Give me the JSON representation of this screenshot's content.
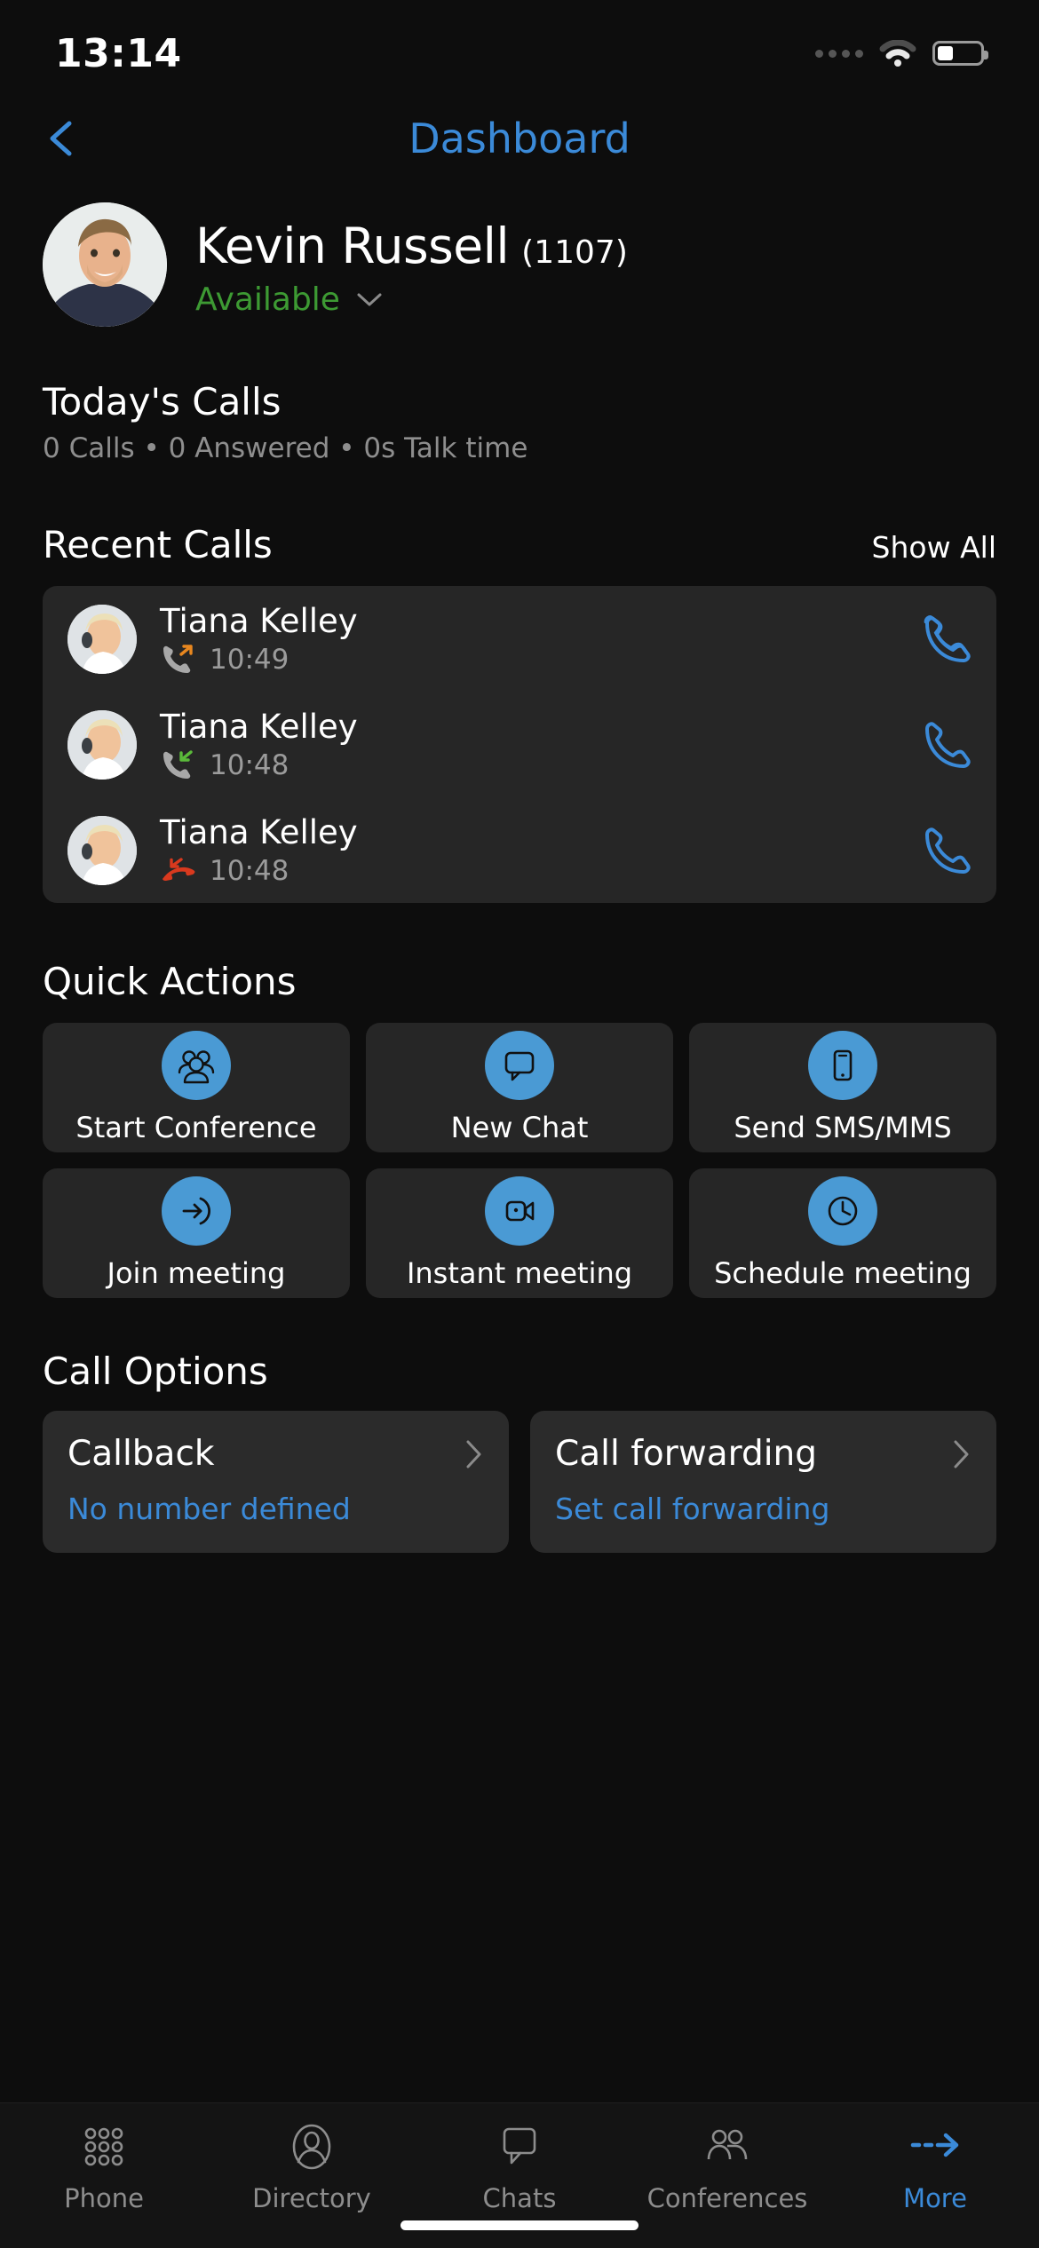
{
  "statusbar": {
    "time": "13:14",
    "signal_icon": "signal-dots-icon",
    "wifi_icon": "wifi-icon",
    "battery_icon": "battery-icon"
  },
  "navbar": {
    "back_icon": "chevron-left-icon",
    "title": "Dashboard"
  },
  "profile": {
    "avatar_icon": "user-avatar-photo",
    "name": "Kevin Russell",
    "extension": "(1107)",
    "status": "Available",
    "status_chevron_icon": "chevron-down-icon"
  },
  "today": {
    "title": "Today's Calls",
    "summary": "0 Calls • 0 Answered • 0s Talk time"
  },
  "recent": {
    "title": "Recent Calls",
    "show_all": "Show All",
    "calls": [
      {
        "name": "Tiana Kelley",
        "time": "10:49",
        "direction": "outgoing",
        "direction_icon": "call-outgoing-icon",
        "action_icon": "phone-call-icon",
        "avatar_icon": "contact-avatar-photo"
      },
      {
        "name": "Tiana Kelley",
        "time": "10:48",
        "direction": "incoming",
        "direction_icon": "call-incoming-icon",
        "action_icon": "phone-call-icon",
        "avatar_icon": "contact-avatar-photo"
      },
      {
        "name": "Tiana Kelley",
        "time": "10:48",
        "direction": "missed",
        "direction_icon": "call-missed-icon",
        "action_icon": "phone-call-icon",
        "avatar_icon": "contact-avatar-photo"
      }
    ]
  },
  "quick_actions": {
    "title": "Quick Actions",
    "tiles": [
      {
        "label": "Start Conference",
        "icon": "group-people-icon"
      },
      {
        "label": "New Chat",
        "icon": "speech-bubble-icon"
      },
      {
        "label": "Send SMS/MMS",
        "icon": "mobile-phone-icon"
      },
      {
        "label": "Join meeting",
        "icon": "arrow-enter-icon"
      },
      {
        "label": "Instant meeting",
        "icon": "video-camera-icon"
      },
      {
        "label": "Schedule meeting",
        "icon": "clock-icon"
      }
    ]
  },
  "call_options": {
    "title": "Call Options",
    "cards": [
      {
        "title": "Callback",
        "subtitle": "No number defined",
        "chevron_icon": "chevron-right-icon"
      },
      {
        "title": "Call forwarding",
        "subtitle": "Set call forwarding",
        "chevron_icon": "chevron-right-icon"
      }
    ]
  },
  "tabbar": {
    "tabs": [
      {
        "label": "Phone",
        "icon": "dialpad-icon",
        "active": false
      },
      {
        "label": "Directory",
        "icon": "contact-person-icon",
        "active": false
      },
      {
        "label": "Chats",
        "icon": "speech-bubble-icon",
        "active": false
      },
      {
        "label": "Conferences",
        "icon": "group-people-icon",
        "active": false
      },
      {
        "label": "More",
        "icon": "dashed-arrow-right-icon",
        "active": true
      }
    ]
  },
  "colors": {
    "accent": "#3b8ad8",
    "available_green": "#3d9a33",
    "outgoing_orange": "#e8871f",
    "incoming_green": "#5aba3a",
    "missed_red": "#d9391e",
    "background": "#0d0d0d",
    "card": "#262626"
  }
}
